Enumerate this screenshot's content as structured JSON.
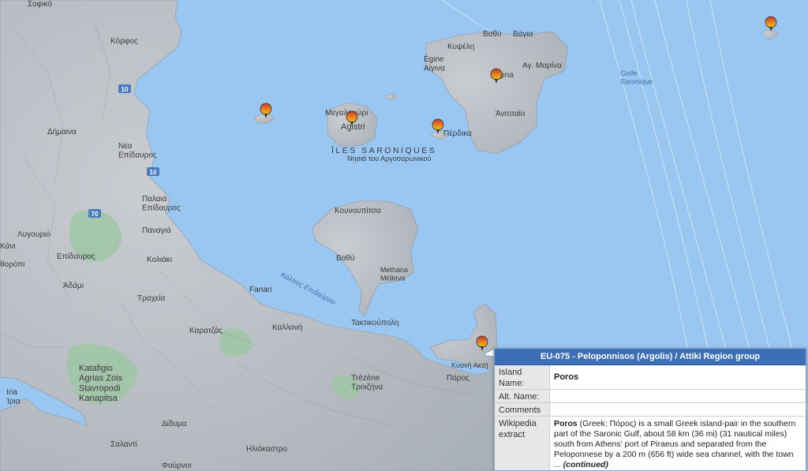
{
  "map": {
    "labels": {
      "sofiko": "Σοφικό",
      "korfos": "Κόρφος",
      "dimaina": "Δήμαινα",
      "nea_epidavros": "Νέα\nΕπίδαυρος",
      "palaia_epidavros": "Παλαιά\nΕπίδαυρος",
      "panagia": "Παναγιά",
      "lygourio": "Λυγουριό",
      "epidavros": "Επίδαυρος",
      "koliaki": "Κολιάκι",
      "adami": "Άδάμι",
      "traxeia": "Τραχεία",
      "kani": "Κάνι",
      "tharopi": "θορόπι",
      "fanari": "Fanari",
      "karatzas": "Καρατζάς",
      "kalloni": "Καλλονή",
      "taktikoupoli": "Τακτικούπολη",
      "trizina": "Trézène\nΤροιζήνα",
      "poros_town": "Πόρος",
      "kapis": "Κυανή Ακτή",
      "iria": "Iria\nΊρια",
      "katafigio": "Katafigio\nAgrias Zois\nStavropodi\nKanapitsa",
      "didyma": "Δίδυμα",
      "salanti": "Σαλαντί",
      "iliokastro": "Ηλιόκαστρο",
      "foyrnoi": "Φούρνοι",
      "megalochori": "Μεγαλοχώρι",
      "agistri": "Agistri",
      "iles_saroniques": "ÎLES SARONIQUES",
      "nisia": "Νησιά του Αργοσαρωνικού",
      "perdika": "Πέρδικα",
      "egine": "Égine\nΑίγινα",
      "kypseli": "Κυψέλη",
      "vathy_n": "Βαθύ",
      "vagia": "Βάγια",
      "ag_marina": "Αγ. Μαρίνα",
      "aegina_town": "gina",
      "anitsaio": "Άνιτσαίο",
      "golfe": "Golfe\nSaronique",
      "kounoupitsa": "Κουνουπίτσα",
      "vathy_s": "Βαθύ",
      "methana": "Methana\nΜέθανα",
      "kolpos": "Κόλπος Επιδαύρου",
      "poros_label": "Poros"
    },
    "roads": [
      "10",
      "10",
      "70"
    ],
    "pin_colors": [
      "#c0392b",
      "#e67e22",
      "#f1c40f"
    ]
  },
  "popup": {
    "title": "EU-075 - Peloponnisos (Argolis) / Attiki Region group",
    "rows": {
      "island_label": "Island Name:",
      "island_value": "Poros",
      "alt_label": "Alt. Name:",
      "alt_value": "",
      "comments_label": "Comments",
      "comments_value": "",
      "wiki_label": "Wikipedia extract",
      "wiki_bold": "Poros",
      "wiki_text": " (Greek: Πόρος) is a small Greek island-pair in the southern part of the Saronic Gulf, about 58 km (36 mi) (31 nautical miles) south from Athens' port of Piraeus and separated from the Peloponnese by a 200 m (656 ft) wide sea channel, with the town ... ",
      "wiki_more": "(continued)"
    }
  }
}
